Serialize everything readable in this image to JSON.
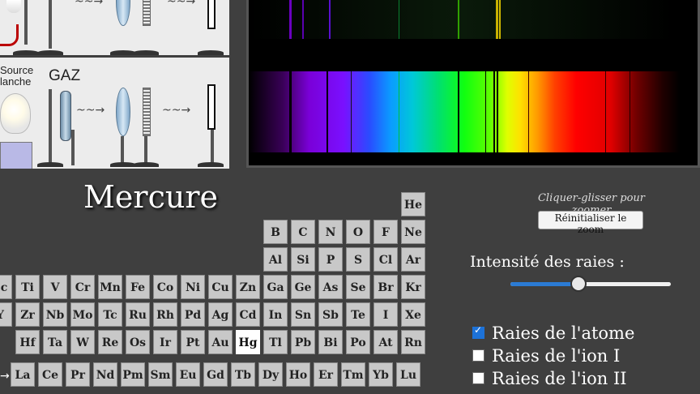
{
  "apparatus": {
    "source_label_line1": "Source",
    "source_label_line2": "lanche",
    "gas_label": "GAZ",
    "wave_symbol": "~~→"
  },
  "element": {
    "name": "Mercure",
    "selected_symbol": "Hg"
  },
  "periodic_table": {
    "rows": [
      [
        "He"
      ],
      [
        "B",
        "C",
        "N",
        "O",
        "F",
        "Ne"
      ],
      [
        "Al",
        "Si",
        "P",
        "S",
        "Cl",
        "Ar"
      ],
      [
        "Sc",
        "Ti",
        "V",
        "Cr",
        "Mn",
        "Fe",
        "Co",
        "Ni",
        "Cu",
        "Zn",
        "Ga",
        "Ge",
        "As",
        "Se",
        "Br",
        "Kr"
      ],
      [
        "Y",
        "Zr",
        "Nb",
        "Mo",
        "Tc",
        "Ru",
        "Rh",
        "Pd",
        "Ag",
        "Cd",
        "In",
        "Sn",
        "Sb",
        "Te",
        "I",
        "Xe"
      ],
      [
        "Hf",
        "Ta",
        "W",
        "Re",
        "Os",
        "Ir",
        "Pt",
        "Au",
        "Hg",
        "Tl",
        "Pb",
        "Bi",
        "Po",
        "At",
        "Rn"
      ],
      [
        "La",
        "Ce",
        "Pr",
        "Nd",
        "Pm",
        "Sm",
        "Eu",
        "Gd",
        "Tb",
        "Dy",
        "Ho",
        "Er",
        "Tm",
        "Yb",
        "Lu"
      ]
    ]
  },
  "zoom": {
    "hint": "Cliquer-glisser pour zoomer",
    "reset_label": "Réinitialiser le zoom"
  },
  "intensity": {
    "label": "Intensité des raies :",
    "value": 0.42
  },
  "checkboxes": [
    {
      "label": "Raies de l'atome",
      "checked": true
    },
    {
      "label": "Raies de l'ion I",
      "checked": false
    },
    {
      "label": "Raies de l'ion II",
      "checked": false
    }
  ],
  "lanthanide_arrow": "→"
}
